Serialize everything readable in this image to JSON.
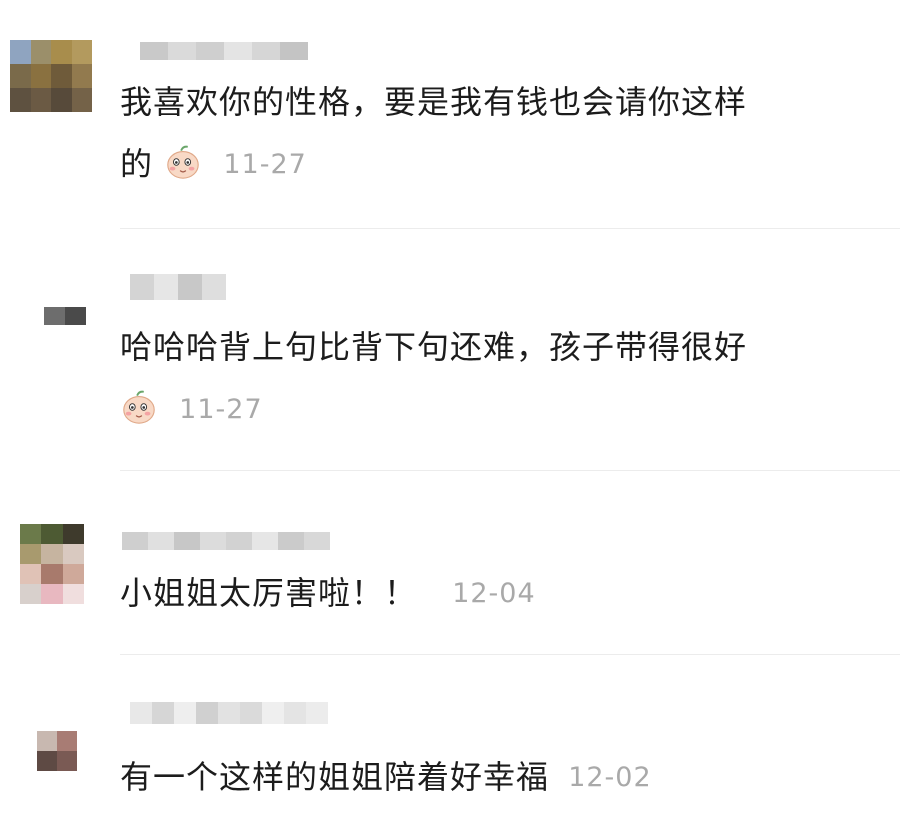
{
  "comments": [
    {
      "line1": "我喜欢你的性格，要是我有钱也会请你这样",
      "line2": "的",
      "emoji": "blush-peach-emoji",
      "date": "11-27"
    },
    {
      "line1": "哈哈哈背上句比背下句还难，孩子带得很好",
      "emoji": "blush-peach-emoji",
      "date": "11-27"
    },
    {
      "line1": "小姐姐太厉害啦！！",
      "date": "12-04"
    },
    {
      "line1": "有一个这样的姐姐陪着好幸福",
      "date": "12-02"
    }
  ],
  "colors": {
    "text": "#1c1c1c",
    "date": "#a9a9a9",
    "divider": "#ececec",
    "username_blur": "#d0d0d0"
  }
}
